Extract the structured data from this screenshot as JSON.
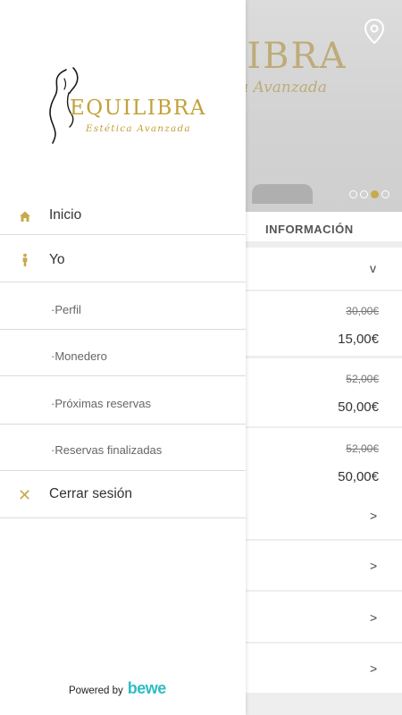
{
  "drawer": {
    "logo": {
      "brand_name": "EQUILIBRA",
      "tagline": "Estética Avanzada"
    },
    "menu": [
      {
        "label": "Inicio",
        "icon": "home-icon"
      },
      {
        "label": "Yo",
        "icon": "person-icon"
      },
      {
        "label": "·Perfil"
      },
      {
        "label": "·Monedero"
      },
      {
        "label": "·Próximas reservas"
      },
      {
        "label": "·Reservas finalizadas"
      },
      {
        "label": "Cerrar sesión",
        "icon": "close-icon"
      }
    ],
    "powered_by": {
      "text": "Powered by",
      "brand": "bewe"
    }
  },
  "background": {
    "hero": {
      "sign_text_main": "ILIBRA",
      "sign_text_sub": "a Avanzada",
      "carousel_active_index": 2,
      "carousel_count": 4
    },
    "info_title": "INFORMACIÓN",
    "services": [
      {
        "old_price": "30,00€",
        "price": "15,00€"
      },
      {
        "old_price": "52,00€",
        "price": "50,00€"
      },
      {
        "old_price": "52,00€",
        "price": "50,00€"
      }
    ],
    "chevron_down": "v",
    "chevron_right": ">"
  },
  "colors": {
    "accent_gold": "#c9a94d",
    "logo_gold": "#c2a13a",
    "bewe_teal": "#2fbcc4",
    "divider": "#dcdcdc"
  }
}
